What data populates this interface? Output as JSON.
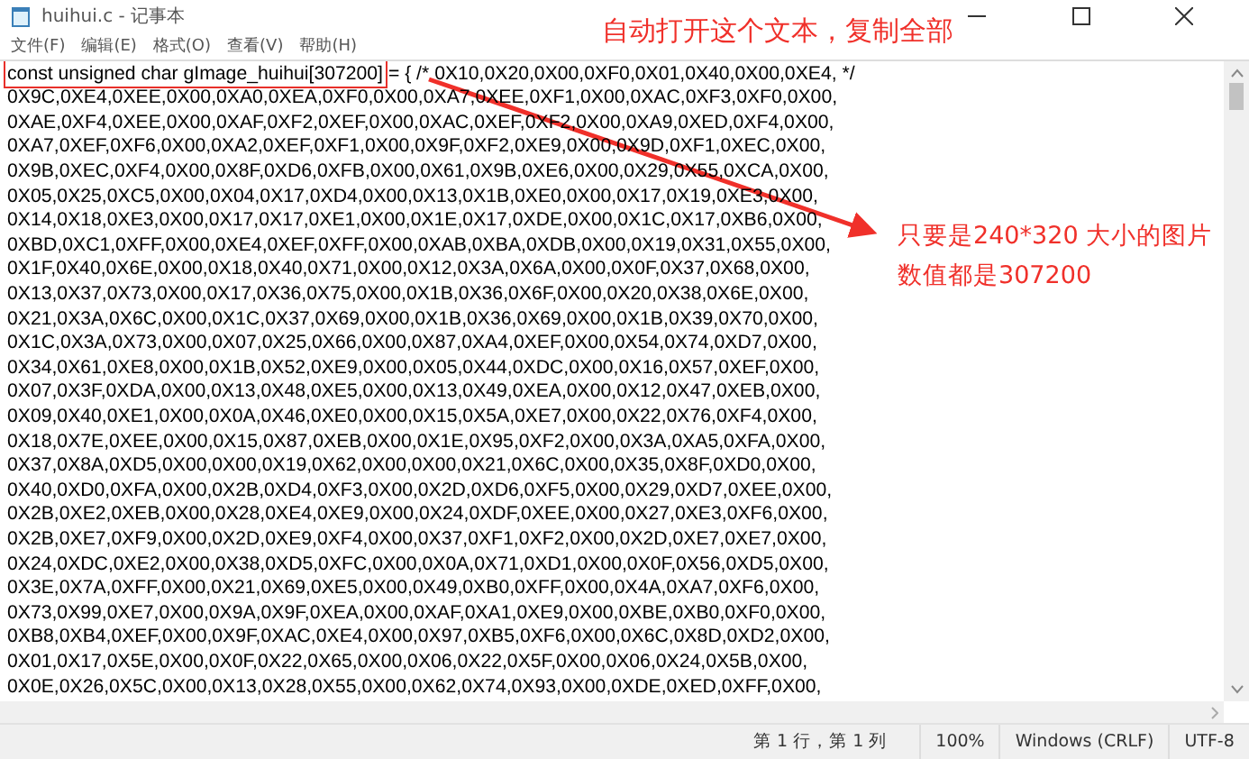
{
  "window": {
    "title": "huihui.c - 记事本"
  },
  "menu": [
    "文件(F)",
    "编辑(E)",
    "格式(O)",
    "查看(V)",
    "帮助(H)"
  ],
  "first_line": {
    "boxed_text": "const unsigned char gImage_huihui[307200]",
    "rest": " = { /* 0X10,0X20,0X00,0XF0,0X01,0X40,0X00,0XE4, */"
  },
  "lines": [
    "0X9C,0XE4,0XEE,0X00,0XA0,0XEA,0XF0,0X00,0XA7,0XEE,0XF1,0X00,0XAC,0XF3,0XF0,0X00,",
    "0XAE,0XF4,0XEE,0X00,0XAF,0XF2,0XEF,0X00,0XAC,0XEF,0XF2,0X00,0XA9,0XED,0XF4,0X00,",
    "0XA7,0XEF,0XF6,0X00,0XA2,0XEF,0XF1,0X00,0X9F,0XF2,0XE9,0X00,0X9D,0XF1,0XEC,0X00,",
    "0X9B,0XEC,0XF4,0X00,0X8F,0XD6,0XFB,0X00,0X61,0X9B,0XE6,0X00,0X29,0X55,0XCA,0X00,",
    "0X05,0X25,0XC5,0X00,0X04,0X17,0XD4,0X00,0X13,0X1B,0XE0,0X00,0X17,0X19,0XE3,0X00,",
    "0X14,0X18,0XE3,0X00,0X17,0X17,0XE1,0X00,0X1E,0X17,0XDE,0X00,0X1C,0X17,0XB6,0X00,",
    "0XBD,0XC1,0XFF,0X00,0XE4,0XEF,0XFF,0X00,0XAB,0XBA,0XDB,0X00,0X19,0X31,0X55,0X00,",
    "0X1F,0X40,0X6E,0X00,0X18,0X40,0X71,0X00,0X12,0X3A,0X6A,0X00,0X0F,0X37,0X68,0X00,",
    "0X13,0X37,0X73,0X00,0X17,0X36,0X75,0X00,0X1B,0X36,0X6F,0X00,0X20,0X38,0X6E,0X00,",
    "0X21,0X3A,0X6C,0X00,0X1C,0X37,0X69,0X00,0X1B,0X36,0X69,0X00,0X1B,0X39,0X70,0X00,",
    "0X1C,0X3A,0X73,0X00,0X07,0X25,0X66,0X00,0X87,0XA4,0XEF,0X00,0X54,0X74,0XD7,0X00,",
    "0X34,0X61,0XE8,0X00,0X1B,0X52,0XE9,0X00,0X05,0X44,0XDC,0X00,0X16,0X57,0XEF,0X00,",
    "0X07,0X3F,0XDA,0X00,0X13,0X48,0XE5,0X00,0X13,0X49,0XEA,0X00,0X12,0X47,0XEB,0X00,",
    "0X09,0X40,0XE1,0X00,0X0A,0X46,0XE0,0X00,0X15,0X5A,0XE7,0X00,0X22,0X76,0XF4,0X00,",
    "0X18,0X7E,0XEE,0X00,0X15,0X87,0XEB,0X00,0X1E,0X95,0XF2,0X00,0X3A,0XA5,0XFA,0X00,",
    "0X37,0X8A,0XD5,0X00,0X00,0X19,0X62,0X00,0X00,0X21,0X6C,0X00,0X35,0X8F,0XD0,0X00,",
    "0X40,0XD0,0XFA,0X00,0X2B,0XD4,0XF3,0X00,0X2D,0XD6,0XF5,0X00,0X29,0XD7,0XEE,0X00,",
    "0X2B,0XE2,0XEB,0X00,0X28,0XE4,0XE9,0X00,0X24,0XDF,0XEE,0X00,0X27,0XE3,0XF6,0X00,",
    "0X2B,0XE7,0XF9,0X00,0X2D,0XE9,0XF4,0X00,0X37,0XF1,0XF2,0X00,0X2D,0XE7,0XE7,0X00,",
    "0X24,0XDC,0XE2,0X00,0X38,0XD5,0XFC,0X00,0X0A,0X71,0XD1,0X00,0X0F,0X56,0XD5,0X00,",
    "0X3E,0X7A,0XFF,0X00,0X21,0X69,0XE5,0X00,0X49,0XB0,0XFF,0X00,0X4A,0XA7,0XF6,0X00,",
    "0X73,0X99,0XE7,0X00,0X9A,0X9F,0XEA,0X00,0XAF,0XA1,0XE9,0X00,0XBE,0XB0,0XF0,0X00,",
    "0XB8,0XB4,0XEF,0X00,0X9F,0XAC,0XE4,0X00,0X97,0XB5,0XF6,0X00,0X6C,0X8D,0XD2,0X00,",
    "0X01,0X17,0X5E,0X00,0X0F,0X22,0X65,0X00,0X06,0X22,0X5F,0X00,0X06,0X24,0X5B,0X00,",
    "0X0E,0X26,0X5C,0X00,0X13,0X28,0X55,0X00,0X62,0X74,0X93,0X00,0XDE,0XED,0XFF,0X00,"
  ],
  "annotations": {
    "top_note": "自动打开这个文本，复制全部",
    "side_note": [
      "只要是240*320 大小的图片",
      "数值都是307200"
    ]
  },
  "status_bar": {
    "position": "第 1 行，第 1 列",
    "zoom": "100%",
    "line_ending": "Windows (CRLF)",
    "encoding": "UTF-8"
  }
}
